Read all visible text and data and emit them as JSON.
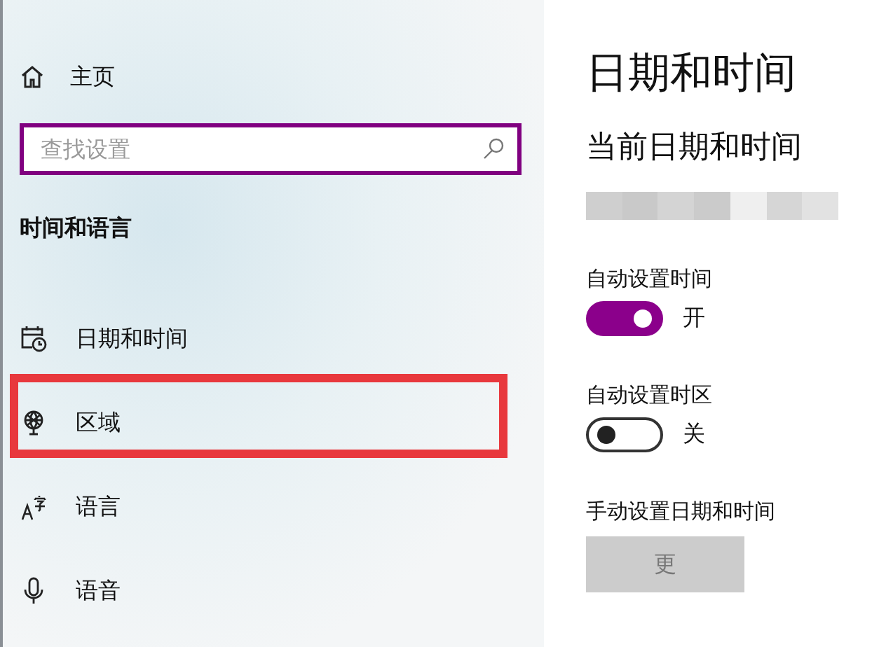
{
  "sidebar": {
    "home": {
      "label": "主页"
    },
    "search": {
      "placeholder": "查找设置"
    },
    "section_title": "时间和语言",
    "items": [
      {
        "kind": "calendar",
        "label": "日期和时间",
        "annotated": false
      },
      {
        "kind": "globe",
        "label": "区域",
        "annotated": true
      },
      {
        "kind": "language",
        "label": "语言",
        "annotated": false
      },
      {
        "kind": "microphone",
        "label": "语音",
        "annotated": false
      }
    ]
  },
  "content": {
    "title": "日期和时间",
    "subtitle": "当前日期和时间",
    "current_time_redacted": true,
    "settings": [
      {
        "label": "自动设置时间",
        "on": true,
        "state_text": "开"
      },
      {
        "label": "自动设置时区",
        "on": false,
        "state_text": "关"
      }
    ],
    "manual": {
      "label": "手动设置日期和时间",
      "button": "更",
      "disabled": true
    }
  }
}
